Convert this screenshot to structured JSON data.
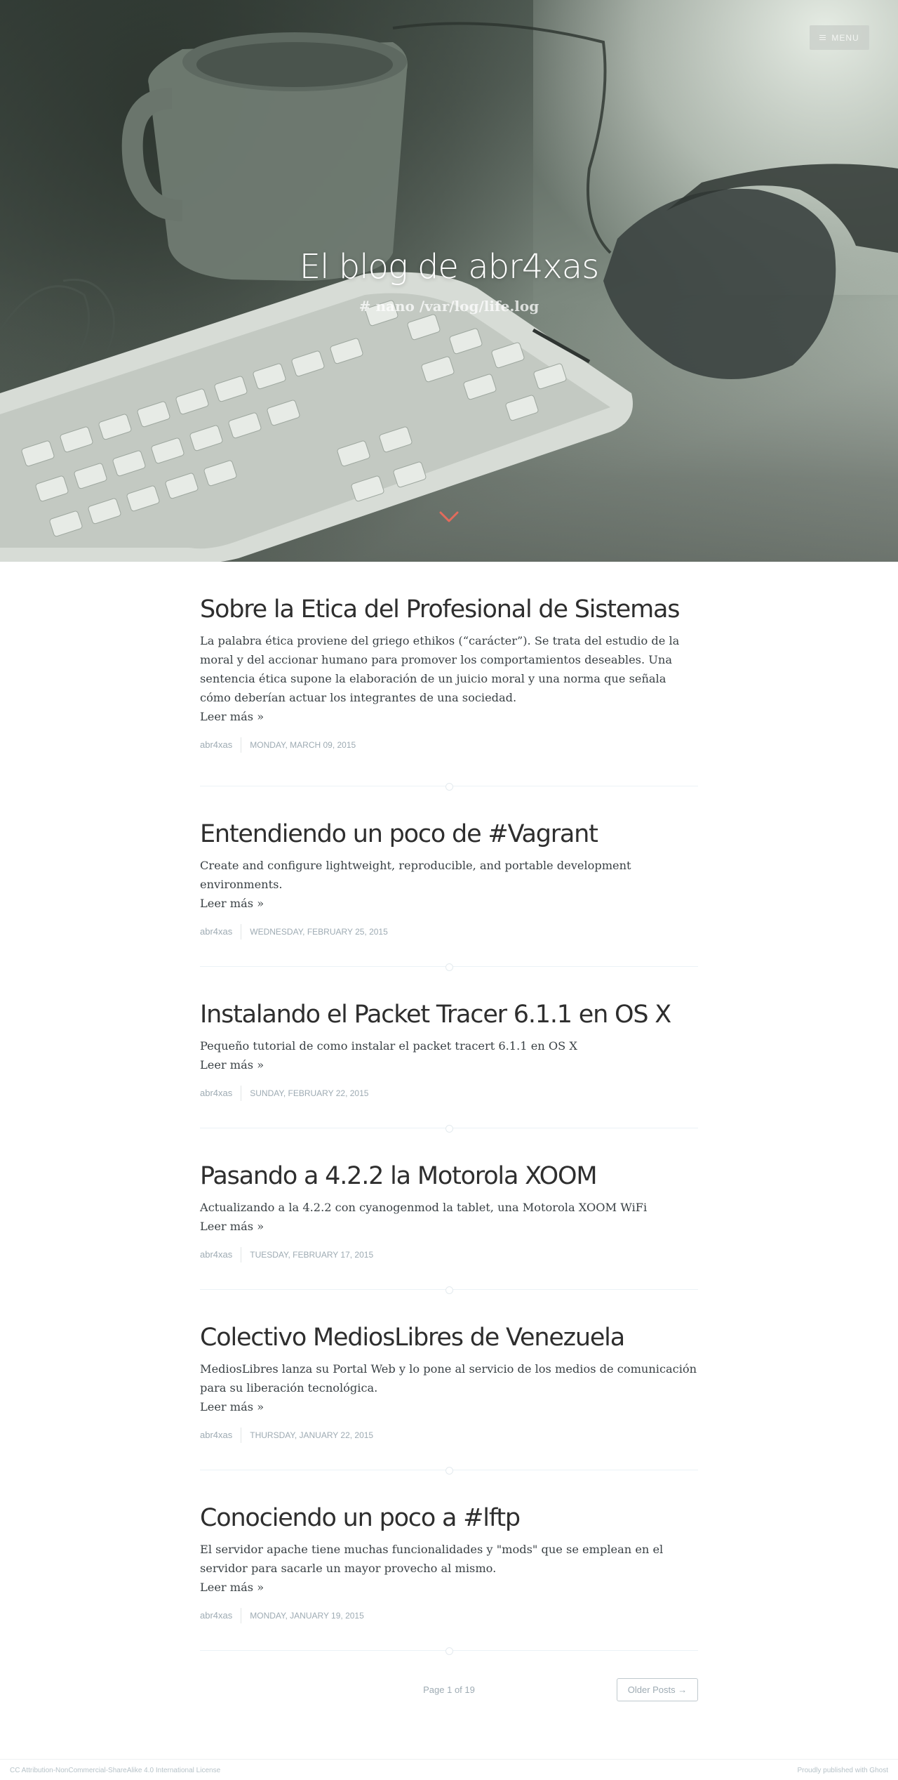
{
  "header": {
    "menu_label": "MENU",
    "blog_title": "El blog de abr4xas",
    "blog_description": "# nano /var/log/life.log"
  },
  "posts": [
    {
      "title": "Sobre la Etica del Profesional de Sistemas",
      "excerpt": "La palabra ética proviene del griego ethikos (“carácter”). Se trata del estudio de la moral y del accionar humano para promover los comportamientos deseables. Una sentencia ética supone la elaboración de un juicio moral y una norma que señala cómo deberían actuar los integrantes de una sociedad.",
      "read_more": "Leer más »",
      "author": "abr4xas",
      "date": "Monday, March 09, 2015"
    },
    {
      "title": "Entendiendo un poco de #Vagrant",
      "excerpt": "Create and configure lightweight, reproducible, and portable development environments.",
      "read_more": "Leer más »",
      "author": "abr4xas",
      "date": "Wednesday, February 25, 2015"
    },
    {
      "title": "Instalando el Packet Tracer 6.1.1 en OS X",
      "excerpt": "Pequeño tutorial de como instalar el packet tracert 6.1.1 en OS X",
      "read_more": "Leer más »",
      "author": "abr4xas",
      "date": "Sunday, February 22, 2015"
    },
    {
      "title": "Pasando a 4.2.2 la Motorola XOOM",
      "excerpt": "Actualizando a la 4.2.2 con cyanogenmod la tablet, una Motorola XOOM WiFi",
      "read_more": "Leer más »",
      "author": "abr4xas",
      "date": "Tuesday, February 17, 2015"
    },
    {
      "title": "Colectivo MediosLibres de Venezuela",
      "excerpt": "MediosLibres lanza su Portal Web y lo pone al servicio de los medios de comunicación para su liberación tecnológica.",
      "read_more": "Leer más »",
      "author": "abr4xas",
      "date": "Thursday, January 22, 2015"
    },
    {
      "title": "Conociendo un poco a #lftp",
      "excerpt": "El servidor apache tiene muchas funcionalidades y \"mods\" que se emplean en el servidor para sacarle un mayor provecho al mismo.",
      "read_more": "Leer más »",
      "author": "abr4xas",
      "date": "Monday, January 19, 2015"
    }
  ],
  "pagination": {
    "page_number": "Page 1 of 19",
    "older_posts": "Older Posts →"
  },
  "footer": {
    "copyright": "CC Attribution-NonCommercial-ShareAlike 4.0 International License",
    "powered_by": "Proudly published with Ghost"
  },
  "colors": {
    "accent_arrow": "#e36b5c",
    "text": "#3a4145",
    "meta": "#9eabb3"
  }
}
